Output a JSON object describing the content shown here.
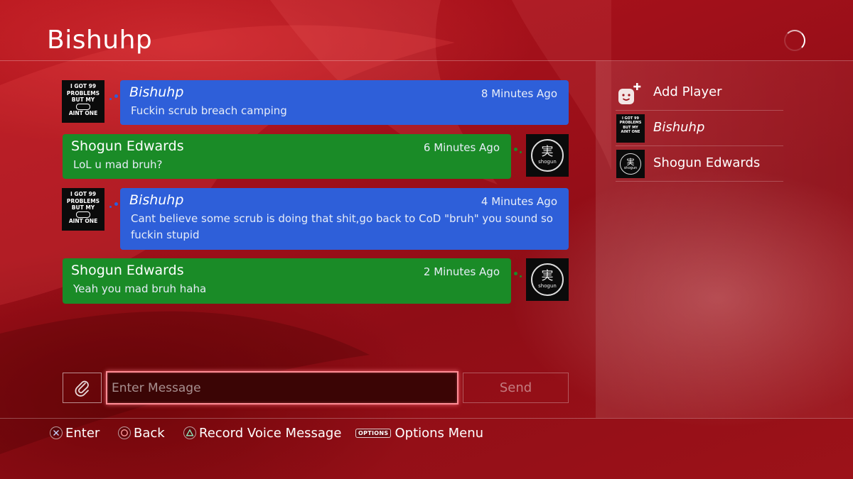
{
  "header": {
    "title": "Bishuhp"
  },
  "messages": [
    {
      "sender": "Bishuhp",
      "time": "8 Minutes Ago",
      "text": "Fuckin scrub breach camping",
      "side": "left",
      "color": "#2e5fd9"
    },
    {
      "sender": "Shogun Edwards",
      "time": "6 Minutes Ago",
      "text": "LoL u mad bruh?",
      "side": "right",
      "color": "#1a8b27"
    },
    {
      "sender": "Bishuhp",
      "time": "4 Minutes Ago",
      "text": "Cant believe some scrub is doing that shit,go back to CoD \"bruh\" you sound so fuckin stupid",
      "side": "left",
      "color": "#2e5fd9"
    },
    {
      "sender": "Shogun Edwards",
      "time": "2 Minutes Ago",
      "text": "Yeah you mad bruh haha",
      "side": "right",
      "color": "#1a8b27"
    }
  ],
  "avatars": {
    "bishuhp": {
      "icon": "meme-avatar",
      "lines": [
        "I GOT 99",
        "PROBLEMS",
        "BUT MY",
        "AINT ONE"
      ]
    },
    "shogun": {
      "icon": "shogun-logo-avatar",
      "glyph": "実",
      "caption": "shogun"
    }
  },
  "composer": {
    "attach_icon": "paperclip-icon",
    "placeholder": "Enter Message",
    "value": "",
    "send_label": "Send"
  },
  "players": {
    "add_label": "Add Player",
    "add_icon": "add-player-icon",
    "list": [
      {
        "name": "Bishuhp"
      },
      {
        "name": "Shogun Edwards"
      }
    ]
  },
  "footer": [
    {
      "icon": "cross-button-icon",
      "label": "Enter"
    },
    {
      "icon": "circle-button-icon",
      "label": "Back"
    },
    {
      "icon": "triangle-button-icon",
      "label": "Record Voice Message"
    },
    {
      "icon": "options-button-icon",
      "glyph": "OPTIONS",
      "label": "Options Menu"
    }
  ]
}
